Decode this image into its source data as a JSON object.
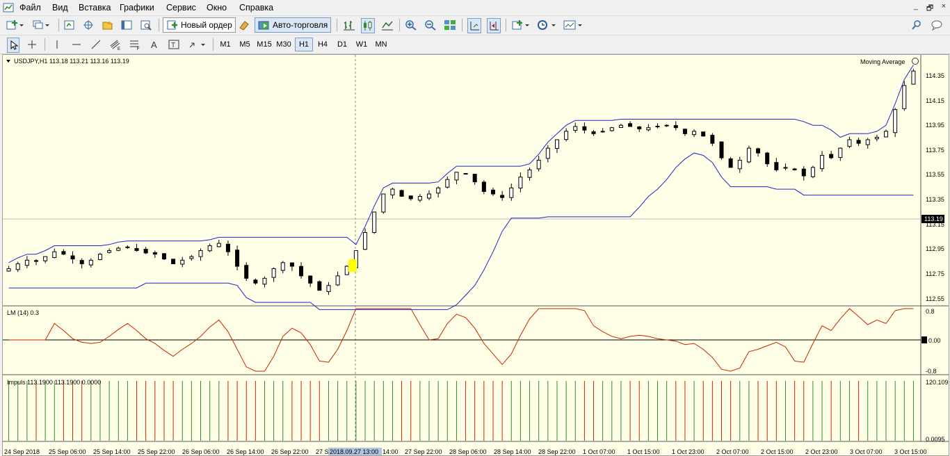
{
  "menu": {
    "items": [
      "Файл",
      "Вид",
      "Вставка",
      "Графики",
      "Сервис",
      "Окно",
      "Справка"
    ]
  },
  "window_controls": [
    "_",
    "🗗",
    "×"
  ],
  "toolbar": {
    "new_order_label": "Новый ордер",
    "auto_trading_label": "Авто-торговля"
  },
  "timeframes": [
    "M1",
    "M5",
    "M15",
    "M30",
    "H1",
    "H4",
    "D1",
    "W1",
    "MN"
  ],
  "active_timeframe": "H1",
  "chart": {
    "header": "USDJPY,H1  113.18 113.21 113.16 113.19",
    "indicator_name": "Moving Average",
    "price_labels": [
      "114.35",
      "114.15",
      "113.95",
      "113.75",
      "113.55",
      "113.35",
      "113.15",
      "112.95",
      "112.75",
      "112.55"
    ],
    "current_price": "113.19",
    "lm_label": "LM (14) 0.3",
    "lm_scale": [
      "0.8",
      "0.00",
      "-0.8"
    ],
    "impuls_label": "Impuls 113.1900 113.1900 0.0000",
    "impuls_scale": [
      "120.1095",
      "0.0095"
    ],
    "time_labels": [
      "24 Sep 2018",
      "25 Sep 06:00",
      "25 Sep 14:00",
      "25 Sep 22:00",
      "26 Sep 06:00",
      "26 Sep 14:00",
      "26 Sep 22:00",
      "27 S",
      "2018.09.27 13:00",
      "14:00",
      "27 Sep 22:00",
      "28 Sep 06:00",
      "28 Sep 14:00",
      "28 Sep 22:00",
      "1 Oct 07:00",
      "1 Oct 15:00",
      "1 Oct 23:00",
      "2 Oct 07:00",
      "2 Oct 15:00",
      "2 Oct 23:00",
      "3 Oct 07:00",
      "3 Oct 15:00"
    ],
    "colors": {
      "bg": "#ffffe8",
      "channel": "#2222cc",
      "lm_line": "#cc2200",
      "bar_green": "#2e8b2e",
      "bar_red": "#cc2200",
      "highlight": "#ffff00"
    }
  },
  "chart_data": {
    "type": "candlestick",
    "symbol": "USDJPY",
    "timeframe": "H1",
    "price_range": [
      112.5,
      114.45
    ],
    "close_path": [
      112.78,
      112.82,
      112.85,
      112.84,
      112.88,
      112.92,
      112.9,
      112.86,
      112.82,
      112.85,
      112.9,
      112.93,
      112.95,
      112.96,
      112.93,
      112.91,
      112.9,
      112.86,
      112.82,
      112.85,
      112.88,
      112.93,
      112.97,
      112.99,
      112.92,
      112.8,
      112.7,
      112.66,
      112.7,
      112.78,
      112.83,
      112.8,
      112.72,
      112.66,
      112.6,
      112.64,
      112.72,
      112.8,
      112.93,
      113.08,
      113.25,
      113.4,
      113.44,
      113.38,
      113.36,
      113.38,
      113.4,
      113.45,
      113.52,
      113.58,
      113.57,
      113.5,
      113.42,
      113.4,
      113.37,
      113.45,
      113.54,
      113.6,
      113.68,
      113.78,
      113.85,
      113.92,
      113.96,
      113.93,
      113.9,
      113.92,
      113.95,
      113.97,
      113.96,
      113.94,
      113.95,
      113.96,
      113.97,
      113.95,
      113.9,
      113.92,
      113.88,
      113.82,
      113.7,
      113.62,
      113.68,
      113.78,
      113.74,
      113.65,
      113.6,
      113.62,
      113.6,
      113.55,
      113.62,
      113.72,
      113.7,
      113.78,
      113.85,
      113.82,
      113.85,
      113.87,
      113.92,
      114.1,
      114.3,
      114.42
    ],
    "lm": {
      "zero_line": 0.0,
      "scale": [
        -0.8,
        0.8
      ]
    },
    "impuls": {
      "scale": [
        0.0095,
        120.1095
      ]
    }
  }
}
